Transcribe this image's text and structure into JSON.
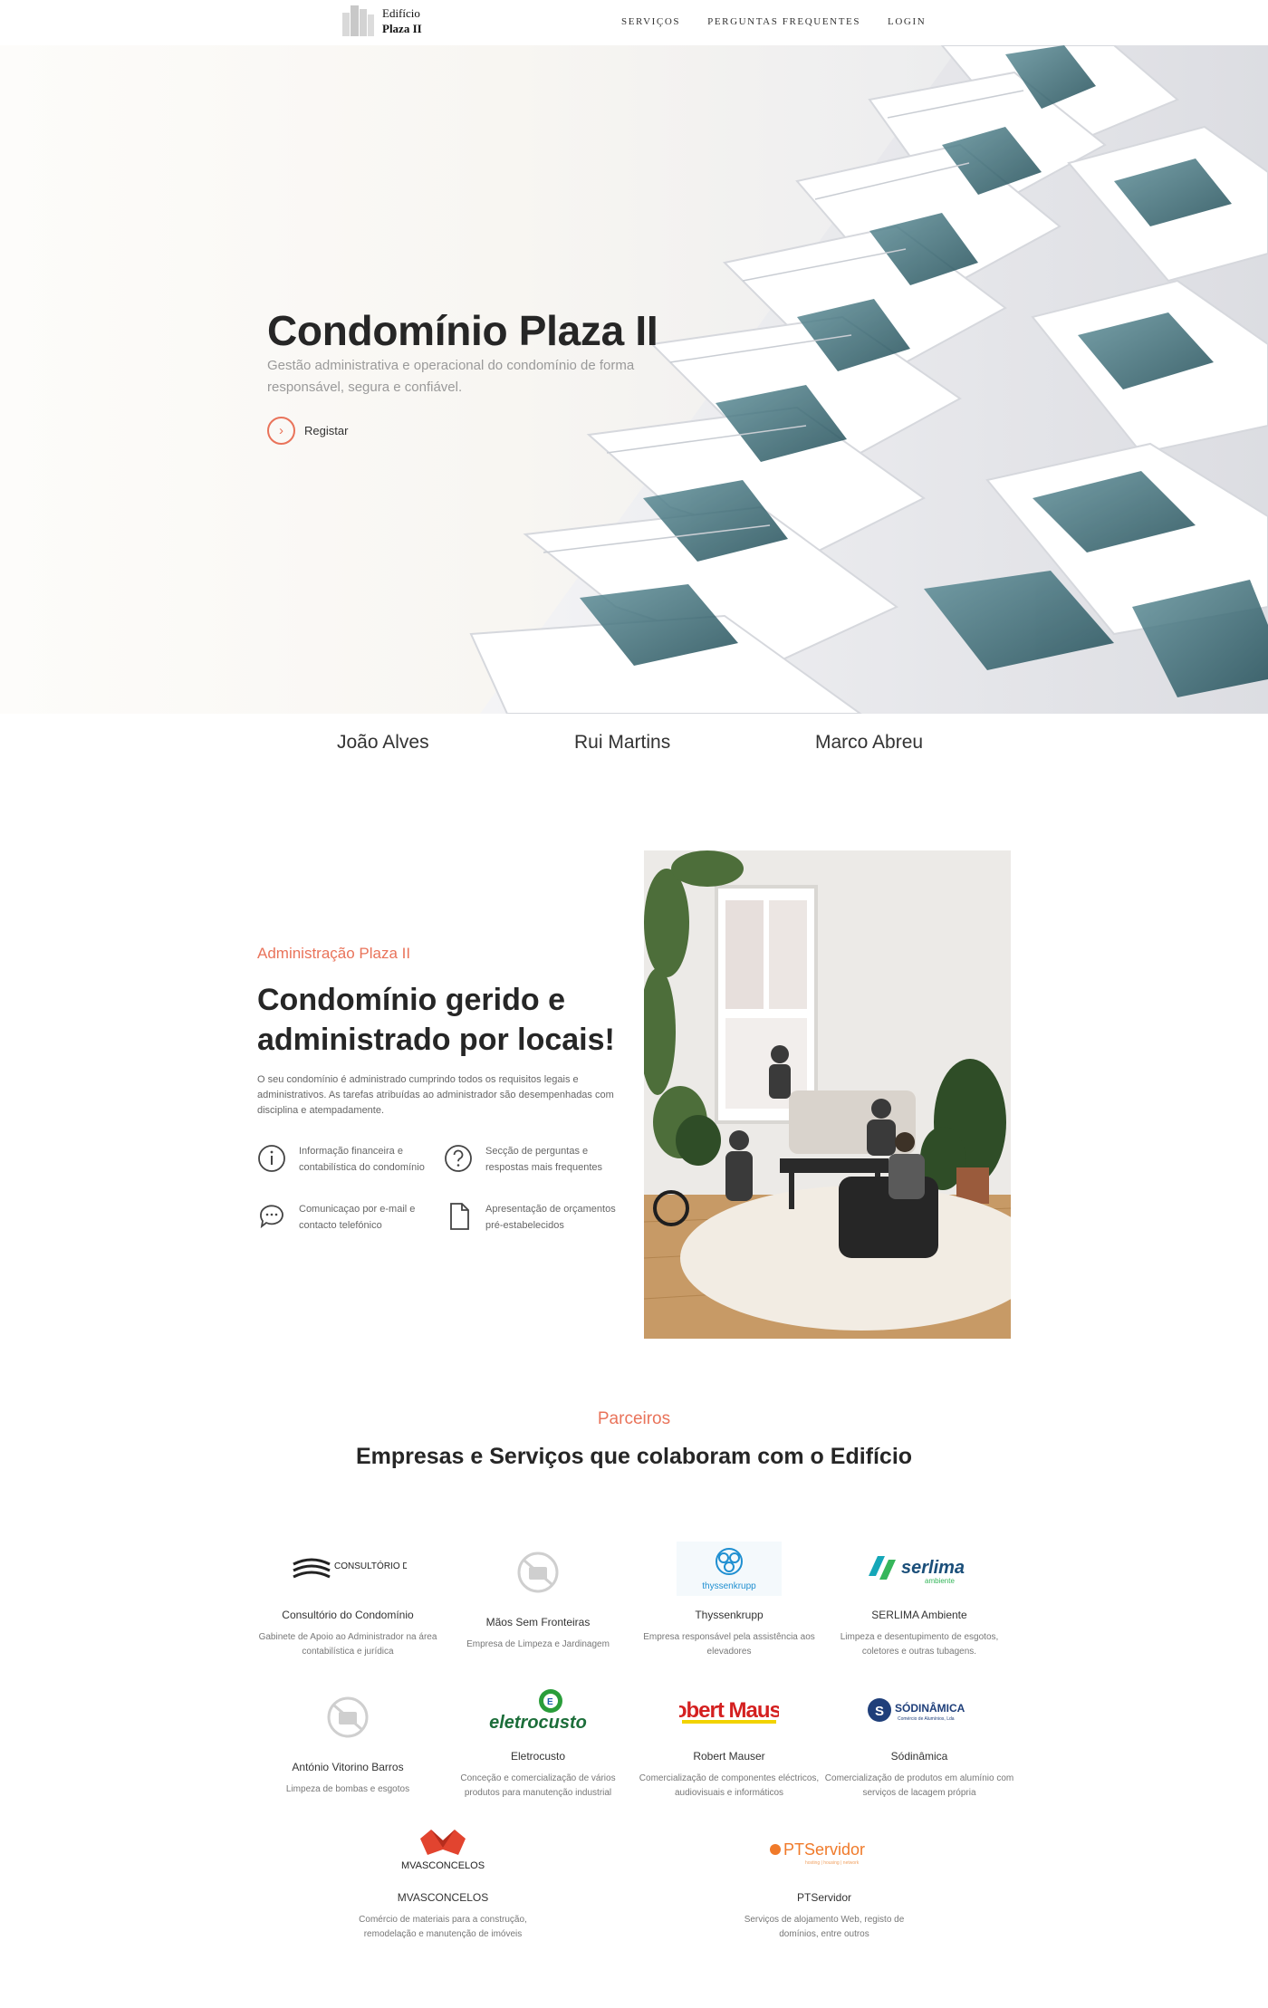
{
  "header": {
    "logo_line1": "Edifício",
    "logo_line2": "Plaza II",
    "nav": [
      "SERVIÇOS",
      "PERGUNTAS FREQUENTES",
      "LOGIN"
    ]
  },
  "hero": {
    "title": "Condomínio Plaza II",
    "subtitle": "Gestão administrativa e operacional do condomínio de forma responsável, segura e confiável.",
    "cta_label": "Registar",
    "cta_icon": "chevron-right-icon"
  },
  "people": [
    "João Alves",
    "Rui Martins",
    "Marco Abreu"
  ],
  "admin": {
    "eyebrow": "Administração Plaza II",
    "title": "Condomínio gerido e administrado por locais!",
    "text": "O seu condomínio é administrado cumprindo todos os requisitos legais e administrativos. As tarefas atribuídas ao administrador são desempenhadas com disciplina e atempadamente.",
    "features": [
      {
        "icon": "info-icon",
        "text": "Informação financeira e contabilística do condomínio"
      },
      {
        "icon": "question-icon",
        "text": "Secção de perguntas e respostas mais frequentes"
      },
      {
        "icon": "chat-icon",
        "text": "Comunicaçao por e-mail e contacto telefónico"
      },
      {
        "icon": "document-icon",
        "text": "Apresentação de orçamentos pré-estabelecidos"
      }
    ]
  },
  "partners": {
    "eyebrow": "Parceiros",
    "title": "Empresas e Serviços que colaboram com o Edifício",
    "items": [
      {
        "name": "Consultório do Condomínio",
        "desc": "Gabinete de Apoio ao Administrador na área contabilística e jurídica",
        "logo_text": "CONSULTÓRIO DO CONDOMÍNIO"
      },
      {
        "name": "Mãos Sem Fronteiras",
        "desc": "Empresa de Limpeza e Jardinagem",
        "logo_text": ""
      },
      {
        "name": "Thyssenkrupp",
        "desc": "Empresa responsável pela assistência aos elevadores",
        "logo_text": "thyssenkrupp"
      },
      {
        "name": "SERLIMA Ambiente",
        "desc": "Limpeza e desentupimento de esgotos, coletores e outras tubagens.",
        "logo_text": "serlima",
        "logo_sub": "ambiente"
      },
      {
        "name": "António Vitorino Barros",
        "desc": "Limpeza de bombas e esgotos",
        "logo_text": ""
      },
      {
        "name": "Eletrocusto",
        "desc": "Conceção e comercialização de vários produtos para manutenção industrial",
        "logo_text": "eletrocusto"
      },
      {
        "name": "Robert Mauser",
        "desc": "Comercialização de componentes eléctricos, audiovisuais e informáticos",
        "logo_text": "Robert Mauser"
      },
      {
        "name": "Sódinâmica",
        "desc": "Comercialização de produtos em alumínio com serviços de lacagem própria",
        "logo_text": "SÓDINÂMICA",
        "logo_sub": "Comércio de Alumínios, Lda"
      },
      {
        "name": "MVASCONCELOS",
        "desc": "Comércio de materiais para a construção, remodelação e manutenção de imóveis",
        "logo_text": "MVASCONCELOS"
      },
      {
        "name": "PTServidor",
        "desc": "Serviços de alojamento Web, registo de domínios, entre outros",
        "logo_text": "PTServidor",
        "logo_sub": "hosting | housing | network"
      }
    ]
  },
  "colors": {
    "accent": "#e9735a",
    "heading": "#262626",
    "muted": "#9a9a9a"
  }
}
